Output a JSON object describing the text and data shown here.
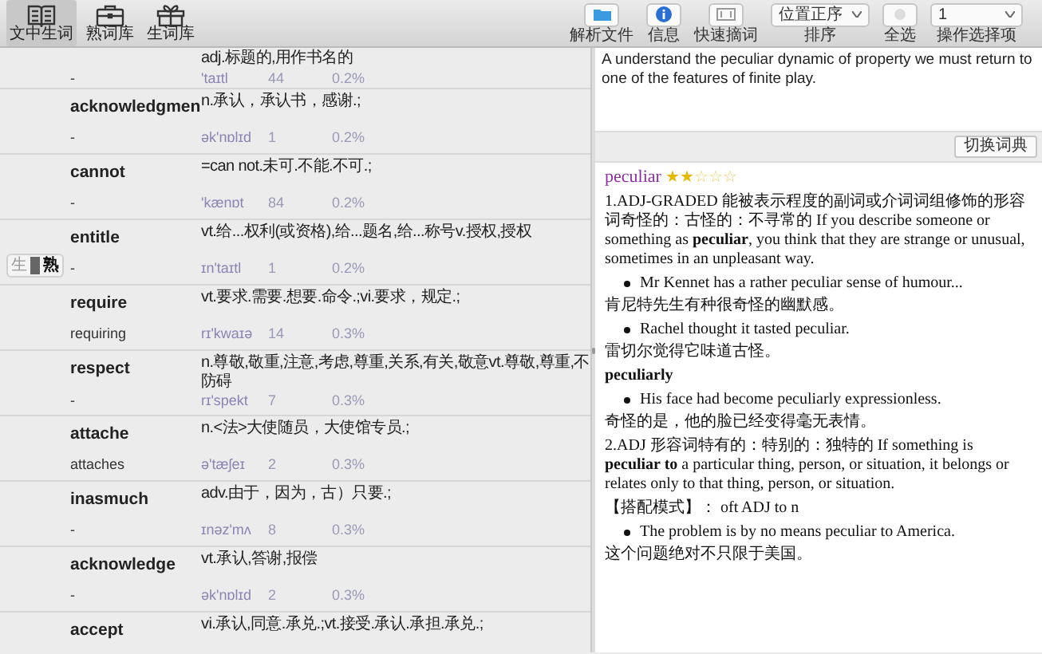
{
  "toolbar_left": [
    {
      "label": "文中生词",
      "selected": true
    },
    {
      "label": "熟词库",
      "selected": false
    },
    {
      "label": "生词库",
      "selected": false
    }
  ],
  "toolbar_right": [
    {
      "kind": "button",
      "label": "解析文件"
    },
    {
      "kind": "button",
      "label": "信息"
    },
    {
      "kind": "button",
      "label": "快速摘词"
    },
    {
      "kind": "dropdown",
      "label": "排序",
      "value": "位置正序"
    },
    {
      "kind": "checkbox",
      "label": "全选",
      "checked": false
    },
    {
      "kind": "dropdown",
      "label": "操作选择项",
      "value": "1"
    }
  ],
  "toggle": {
    "options": [
      {
        "label": "生",
        "selected": false
      },
      {
        "label": "熟",
        "selected": true
      }
    ]
  },
  "words": [
    {
      "definition": "adj.标题的,用作书名的",
      "form": "-",
      "phonetic": "'taɪtl",
      "count": "44",
      "percent": "0.2%"
    },
    {
      "word": "acknowledgmen",
      "definition": "n.承认，承认书，感谢.;",
      "form": "-",
      "phonetic": "ək'nɒlɪd",
      "count": "1",
      "percent": "0.2%"
    },
    {
      "word": "cannot",
      "definition": "=can not.未可.不能.不可.;",
      "form": "-",
      "phonetic": "'kænɒt",
      "count": "84",
      "percent": "0.2%"
    },
    {
      "word": "entitle",
      "definition": "vt.给...权利(或资格),给...题名,给...称号v.授权,授权",
      "form": "-",
      "phonetic": "ɪn'taɪtl",
      "count": "1",
      "percent": "0.2%"
    },
    {
      "word": "require",
      "definition": "vt.要求.需要.想要.命令.;vi.要求，规定.;",
      "form": "requiring",
      "phonetic": "rɪ'kwaɪə",
      "count": "14",
      "percent": "0.3%"
    },
    {
      "word": "respect",
      "definition": "n.尊敬,敬重,注意,考虑,尊重,关系,有关,敬意vt.尊敬,尊重,不防碍",
      "form": "-",
      "phonetic": "rɪ'spekt",
      "count": "7",
      "percent": "0.3%"
    },
    {
      "word": "attache",
      "definition": "n.<法>大使随员，大使馆专员.;",
      "form": "attaches",
      "phonetic": "ə'tæʃeɪ",
      "count": "2",
      "percent": "0.3%"
    },
    {
      "word": "inasmuch",
      "definition": "adv.由于，因为，古）只要.;",
      "form": "-",
      "phonetic": "ɪnəz'mʌ",
      "count": "8",
      "percent": "0.3%"
    },
    {
      "word": "acknowledge",
      "definition": "vt.承认,答谢,报偿",
      "form": "-",
      "phonetic": "ək'nɒlɪd",
      "count": "2",
      "percent": "0.3%"
    },
    {
      "word": "accept",
      "definition": "vi.承认,同意.承兑.;vt.接受.承认.承担.承兑.;"
    }
  ],
  "sentence": "A  understand the peculiar dynamic of property we must return to one of the features of finite play.",
  "switch_dictionary_button": "切换词典",
  "entry": {
    "headword": "peculiar",
    "stars": 2,
    "blocks": [
      {
        "kind": "definition",
        "text": "1.ADJ-GRADED 能被表示程度的副词或介词词组修饰的形容词奇怪的：古怪的：不寻常的 If you describe someone or something as **peculiar**, you think that they are strange or unusual, sometimes in an unpleasant way."
      },
      {
        "kind": "example",
        "text": "Mr Kennet has a rather peculiar sense of humour...",
        "translation": "肯尼特先生有种很奇怪的幽默感。"
      },
      {
        "kind": "example",
        "text": "Rachel thought it tasted peculiar.",
        "translation": "雷切尔觉得它味道古怪。"
      },
      {
        "kind": "subhead",
        "text": "peculiarly"
      },
      {
        "kind": "example",
        "text": "His face had become peculiarly expressionless.",
        "translation": "奇怪的是，他的脸已经变得毫无表情。"
      },
      {
        "kind": "definition",
        "text": "2.ADJ 形容词特有的：特别的：独特的 If something is **peculiar to** a particular thing, person, or situation, it belongs or relates only to that thing, person, or situation."
      },
      {
        "kind": "pattern",
        "text": "【搭配模式】： oft ADJ to n"
      },
      {
        "kind": "example",
        "text": "The problem is by no means peculiar to America.",
        "translation": "这个问题绝对不只限于美国。"
      }
    ]
  }
}
